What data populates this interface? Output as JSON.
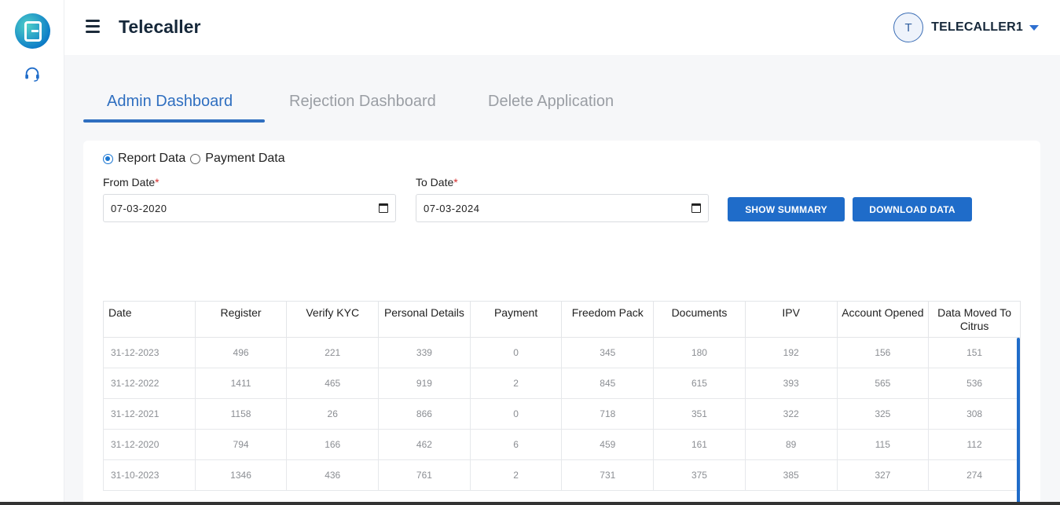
{
  "app": {
    "title": "Telecaller"
  },
  "user": {
    "initial": "T",
    "name": "TELECALLER1"
  },
  "tabs": [
    {
      "label": "Admin Dashboard",
      "active": true
    },
    {
      "label": "Rejection Dashboard",
      "active": false
    },
    {
      "label": "Delete Application",
      "active": false
    }
  ],
  "radios": [
    {
      "label": "Report Data",
      "checked": true
    },
    {
      "label": "Payment Data",
      "checked": false
    }
  ],
  "filters": {
    "from_label": "From Date",
    "from_value": "07-03-2020",
    "to_label": "To Date",
    "to_value": "07-03-2024",
    "required_mark": "*"
  },
  "buttons": {
    "show_summary": "SHOW SUMMARY",
    "download_data": "DOWNLOAD DATA"
  },
  "table": {
    "headers": [
      "Date",
      "Register",
      "Verify KYC",
      "Personal Details",
      "Payment",
      "Freedom Pack",
      "Documents",
      "IPV",
      "Account Opened",
      "Data Moved To Citrus"
    ],
    "rows": [
      [
        "31-12-2023",
        "496",
        "221",
        "339",
        "0",
        "345",
        "180",
        "192",
        "156",
        "151"
      ],
      [
        "31-12-2022",
        "1411",
        "465",
        "919",
        "2",
        "845",
        "615",
        "393",
        "565",
        "536"
      ],
      [
        "31-12-2021",
        "1158",
        "26",
        "866",
        "0",
        "718",
        "351",
        "322",
        "325",
        "308"
      ],
      [
        "31-12-2020",
        "794",
        "166",
        "462",
        "6",
        "459",
        "161",
        "89",
        "115",
        "112"
      ],
      [
        "31-10-2023",
        "1346",
        "436",
        "761",
        "2",
        "731",
        "375",
        "385",
        "327",
        "274"
      ]
    ]
  },
  "colors": {
    "accent": "#1f6cc9",
    "tab_active": "#2f6fc0",
    "title": "#16283a"
  },
  "icons": {
    "logo": "brand-logo-icon",
    "support": "headset-icon",
    "menu": "hamburger-icon",
    "calendar": "calendar-icon",
    "dropdown": "caret-down-icon"
  }
}
